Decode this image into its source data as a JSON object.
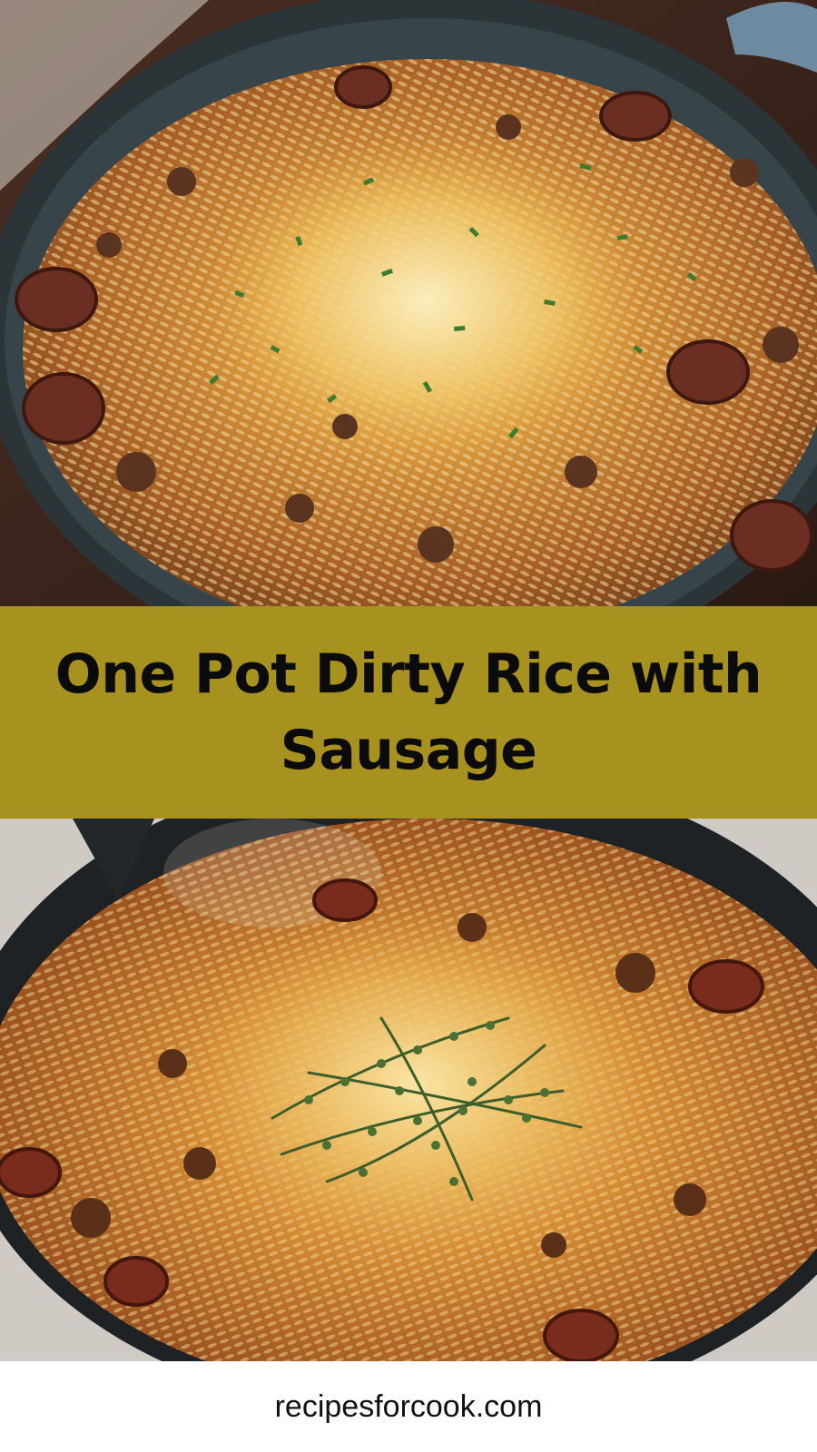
{
  "pin": {
    "title": "One Pot Dirty Rice with Sausage",
    "website": "recipesforcook.com"
  },
  "colors": {
    "title_band": "#A8921F",
    "title_text": "#0B0B0B",
    "footer_bg": "#FFFFFF",
    "footer_text": "#111111"
  },
  "images": {
    "top": "top-photo-dirty-rice-skillet-parsley",
    "bottom": "bottom-photo-dirty-rice-skillet-thyme"
  }
}
